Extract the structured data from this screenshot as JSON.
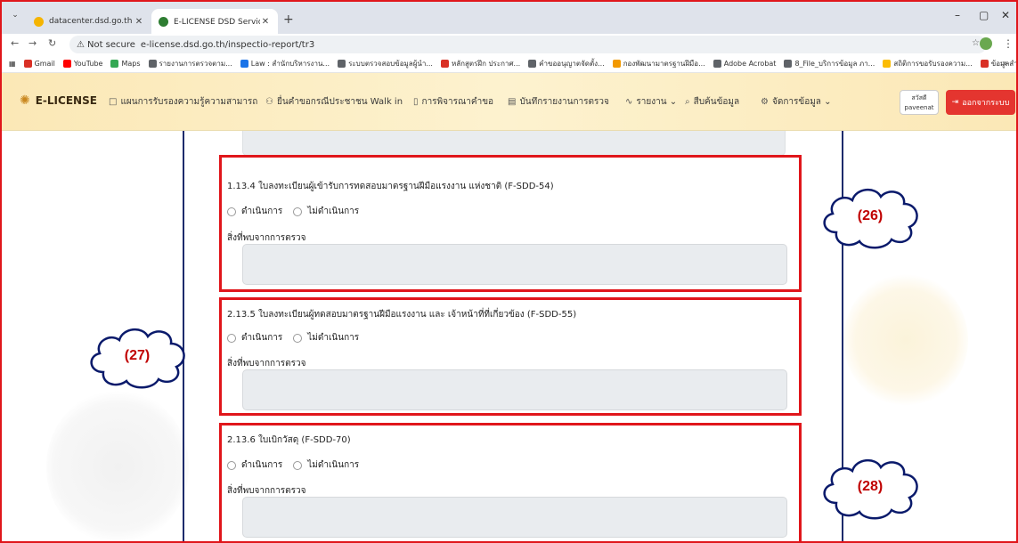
{
  "browser": {
    "tabs": [
      {
        "title": "datacenter.dsd.go.th |",
        "active": false
      },
      {
        "title": "E-LICENSE DSD Service - ระบบบั",
        "active": true
      }
    ],
    "new_tab_glyph": "+",
    "window_controls": [
      "–",
      "▢",
      "✕"
    ],
    "security_label": "Not secure",
    "url": "e-license.dsd.go.th/inspectio-report/tr3",
    "bookmarks": [
      {
        "label": "Gmail",
        "color": "#d93025"
      },
      {
        "label": "YouTube",
        "color": "#ff0000"
      },
      {
        "label": "Maps",
        "color": "#34a853"
      },
      {
        "label": "รายงานการตรวจตาม...",
        "color": "#5f6368"
      },
      {
        "label": "Law : สำนักบริหารงาน...",
        "color": "#1a73e8"
      },
      {
        "label": "ระบบตรวจสอบข้อมูลผู้นำ...",
        "color": "#5f6368"
      },
      {
        "label": "หลักสูตรฝึก ประกาศ...",
        "color": "#d93025"
      },
      {
        "label": "คำขออนุญาตจัดตั้ง...",
        "color": "#5f6368"
      },
      {
        "label": "กองพัฒนามาตรฐานฝีมือ...",
        "color": "#f29900"
      },
      {
        "label": "Adobe Acrobat",
        "color": "#5f6368"
      },
      {
        "label": "8_File_บริการข้อมูล ภา...",
        "color": "#5f6368"
      },
      {
        "label": "สถิติการขอรับรองความ...",
        "color": "#fbbc04"
      },
      {
        "label": "ข้อมูลสำหรับผู้ปฏิบัติงาน...",
        "color": "#d93025"
      }
    ],
    "bookmarks_more": "»"
  },
  "app": {
    "brand": "E-LICENSE",
    "nav_items": [
      {
        "label": "แผนการรับรองความรู้ความสามารถ",
        "icon": "□"
      },
      {
        "label": "ยื่นคำขอกรณีประชาชน Walk in",
        "icon": "⚇"
      },
      {
        "label": "การพิจารณาคำขอ",
        "icon": "▯"
      },
      {
        "label": "บันทึกรายงานการตรวจ",
        "icon": "▤"
      },
      {
        "label": "รายงาน ⌄",
        "icon": "∿"
      },
      {
        "label": "สืบค้นข้อมูล",
        "icon": "⌕"
      },
      {
        "label": "จัดการข้อมูล ⌄",
        "icon": "⚙"
      }
    ],
    "user": {
      "greeting": "สวัสดี",
      "name": "paveenat"
    },
    "logout_label": "ออกจากระบบ"
  },
  "sections": [
    {
      "title": "1.13.4 ใบลงทะเบียนผู้เข้ารับการทดสอบมาตรฐานฝีมือแรงงาน แห่งชาติ (F-SDD-54)",
      "option_yes": "ดำเนินการ",
      "option_no": "ไม่ดำเนินการ",
      "field_label": "สิ่งที่พบจากการตรวจ",
      "field_value": ""
    },
    {
      "title": "2.13.5 ใบลงทะเบียนผู้ทดสอบมาตรฐานฝีมือแรงงาน และ เจ้าหน้าที่ที่เกี่ยวข้อง (F-SDD-55)",
      "option_yes": "ดำเนินการ",
      "option_no": "ไม่ดำเนินการ",
      "field_label": "สิ่งที่พบจากการตรวจ",
      "field_value": ""
    },
    {
      "title": "2.13.6 ใบเบิกวัสดุ (F-SDD-70)",
      "option_yes": "ดำเนินการ",
      "option_no": "ไม่ดำเนินการ",
      "field_label": "สิ่งที่พบจากการตรวจ",
      "field_value": ""
    }
  ],
  "callouts": [
    "(26)",
    "(27)",
    "(28)"
  ],
  "colors": {
    "highlight": "#e0161b",
    "logout": "#e4352f",
    "callout_text": "#c00000",
    "divider": "#1d2b6b"
  }
}
